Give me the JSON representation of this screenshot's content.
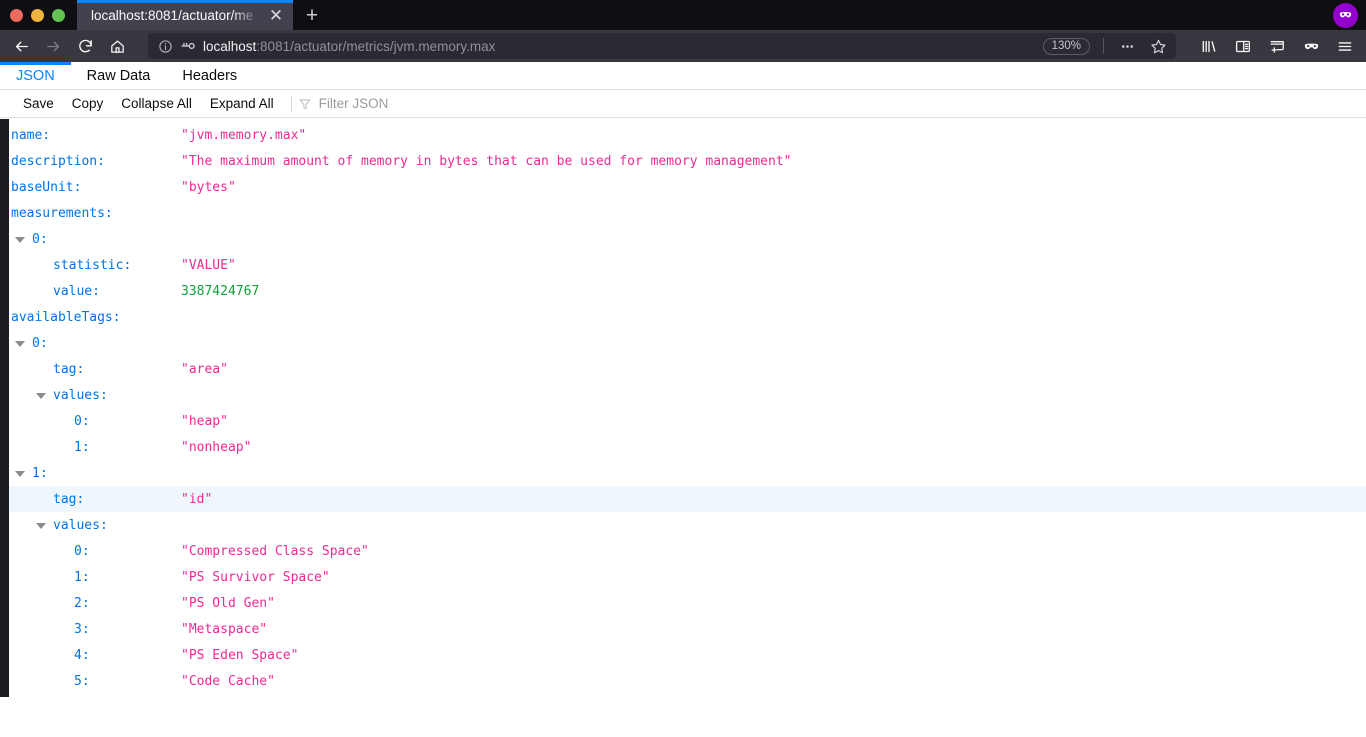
{
  "browser": {
    "window_controls": [
      "close",
      "minimize",
      "maximize"
    ],
    "tab": {
      "title": "localhost:8081/actuator/me",
      "close_label": "✕"
    },
    "new_tab_label": "+",
    "nav": {
      "back": "←",
      "forward": "→",
      "reload": "↻",
      "home": "⌂"
    },
    "urlbar": {
      "host": "localhost",
      "path": ":8081/actuator/metrics/jvm.memory.max",
      "full_url": "localhost:8081/actuator/metrics/jvm.memory.max",
      "zoom_level": "130%",
      "page_actions_label": "…",
      "bookmark_label": "☆"
    },
    "toolbar_icons": [
      "library-icon",
      "sidebar-icon",
      "pocket-icon",
      "container-mask-icon",
      "menu-icon"
    ],
    "account_badge": "container-mask-icon"
  },
  "viewer": {
    "tabs": [
      {
        "label": "JSON",
        "active": true
      },
      {
        "label": "Raw Data",
        "active": false
      },
      {
        "label": "Headers",
        "active": false
      }
    ],
    "toolbar": {
      "save": "Save",
      "copy": "Copy",
      "collapse_all": "Collapse All",
      "expand_all": "Expand All",
      "filter_placeholder": "Filter JSON",
      "filter_value": ""
    }
  },
  "json_rows": [
    {
      "indent": 1,
      "twisty": false,
      "key": "name:",
      "value": "\"jvm.memory.max\"",
      "type": "str",
      "highlight": false
    },
    {
      "indent": 1,
      "twisty": true,
      "key": "description:",
      "value": "\"The maximum amount of memory in bytes that can be used for memory management\"",
      "type": "str",
      "highlight": false
    },
    {
      "indent": 1,
      "twisty": false,
      "key": "baseUnit:",
      "value": "\"bytes\"",
      "type": "str",
      "highlight": false
    },
    {
      "indent": 1,
      "twisty": true,
      "key": "measurements:",
      "value": "",
      "type": "none",
      "highlight": false
    },
    {
      "indent": 2,
      "twisty": true,
      "key": "0:",
      "value": "",
      "type": "none",
      "highlight": false
    },
    {
      "indent": 3,
      "twisty": false,
      "key": "statistic:",
      "value": "\"VALUE\"",
      "type": "str",
      "highlight": false
    },
    {
      "indent": 3,
      "twisty": false,
      "key": "value:",
      "value": "3387424767",
      "type": "num",
      "highlight": false
    },
    {
      "indent": 1,
      "twisty": true,
      "key": "availableTags:",
      "value": "",
      "type": "none",
      "highlight": false
    },
    {
      "indent": 2,
      "twisty": true,
      "key": "0:",
      "value": "",
      "type": "none",
      "highlight": false
    },
    {
      "indent": 3,
      "twisty": false,
      "key": "tag:",
      "value": "\"area\"",
      "type": "str",
      "highlight": false
    },
    {
      "indent": 3,
      "twisty": true,
      "key": "values:",
      "value": "",
      "type": "none",
      "highlight": false
    },
    {
      "indent": 4,
      "twisty": false,
      "key": "0:",
      "value": "\"heap\"",
      "type": "str",
      "highlight": false
    },
    {
      "indent": 4,
      "twisty": false,
      "key": "1:",
      "value": "\"nonheap\"",
      "type": "str",
      "highlight": false
    },
    {
      "indent": 2,
      "twisty": true,
      "key": "1:",
      "value": "",
      "type": "none",
      "highlight": false
    },
    {
      "indent": 3,
      "twisty": false,
      "key": "tag:",
      "value": "\"id\"",
      "type": "str",
      "highlight": true
    },
    {
      "indent": 3,
      "twisty": true,
      "key": "values:",
      "value": "",
      "type": "none",
      "highlight": false
    },
    {
      "indent": 4,
      "twisty": false,
      "key": "0:",
      "value": "\"Compressed Class Space\"",
      "type": "str",
      "highlight": false
    },
    {
      "indent": 4,
      "twisty": false,
      "key": "1:",
      "value": "\"PS Survivor Space\"",
      "type": "str",
      "highlight": false
    },
    {
      "indent": 4,
      "twisty": false,
      "key": "2:",
      "value": "\"PS Old Gen\"",
      "type": "str",
      "highlight": false
    },
    {
      "indent": 4,
      "twisty": false,
      "key": "3:",
      "value": "\"Metaspace\"",
      "type": "str",
      "highlight": false
    },
    {
      "indent": 4,
      "twisty": false,
      "key": "4:",
      "value": "\"PS Eden Space\"",
      "type": "str",
      "highlight": false
    },
    {
      "indent": 4,
      "twisty": false,
      "key": "5:",
      "value": "\"Code Cache\"",
      "type": "str",
      "highlight": false
    }
  ],
  "colors": {
    "accent": "#0a84ff",
    "key": "#0074e8",
    "string": "#ed2a95",
    "number": "#12a13a",
    "row_highlight": "#eff7fd",
    "chrome": "#38373f",
    "badge": "#9400ce"
  }
}
